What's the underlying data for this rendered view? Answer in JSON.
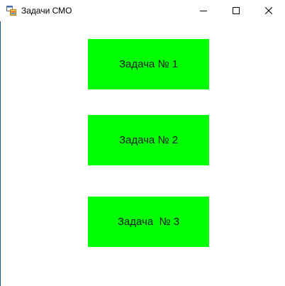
{
  "window": {
    "title": "Задачи СМО",
    "icon": "windows-form-icon"
  },
  "title_controls": {
    "minimize_icon": "minimize-icon",
    "maximize_icon": "maximize-icon",
    "close_icon": "close-icon"
  },
  "buttons": [
    {
      "label": "Задача № 1"
    },
    {
      "label": "Задача № 2"
    },
    {
      "label": "Задача  № 3"
    }
  ],
  "colors": {
    "button_background": "#00ff00",
    "window_background": "#ffffff",
    "accent_edge": "#1f5d87"
  }
}
